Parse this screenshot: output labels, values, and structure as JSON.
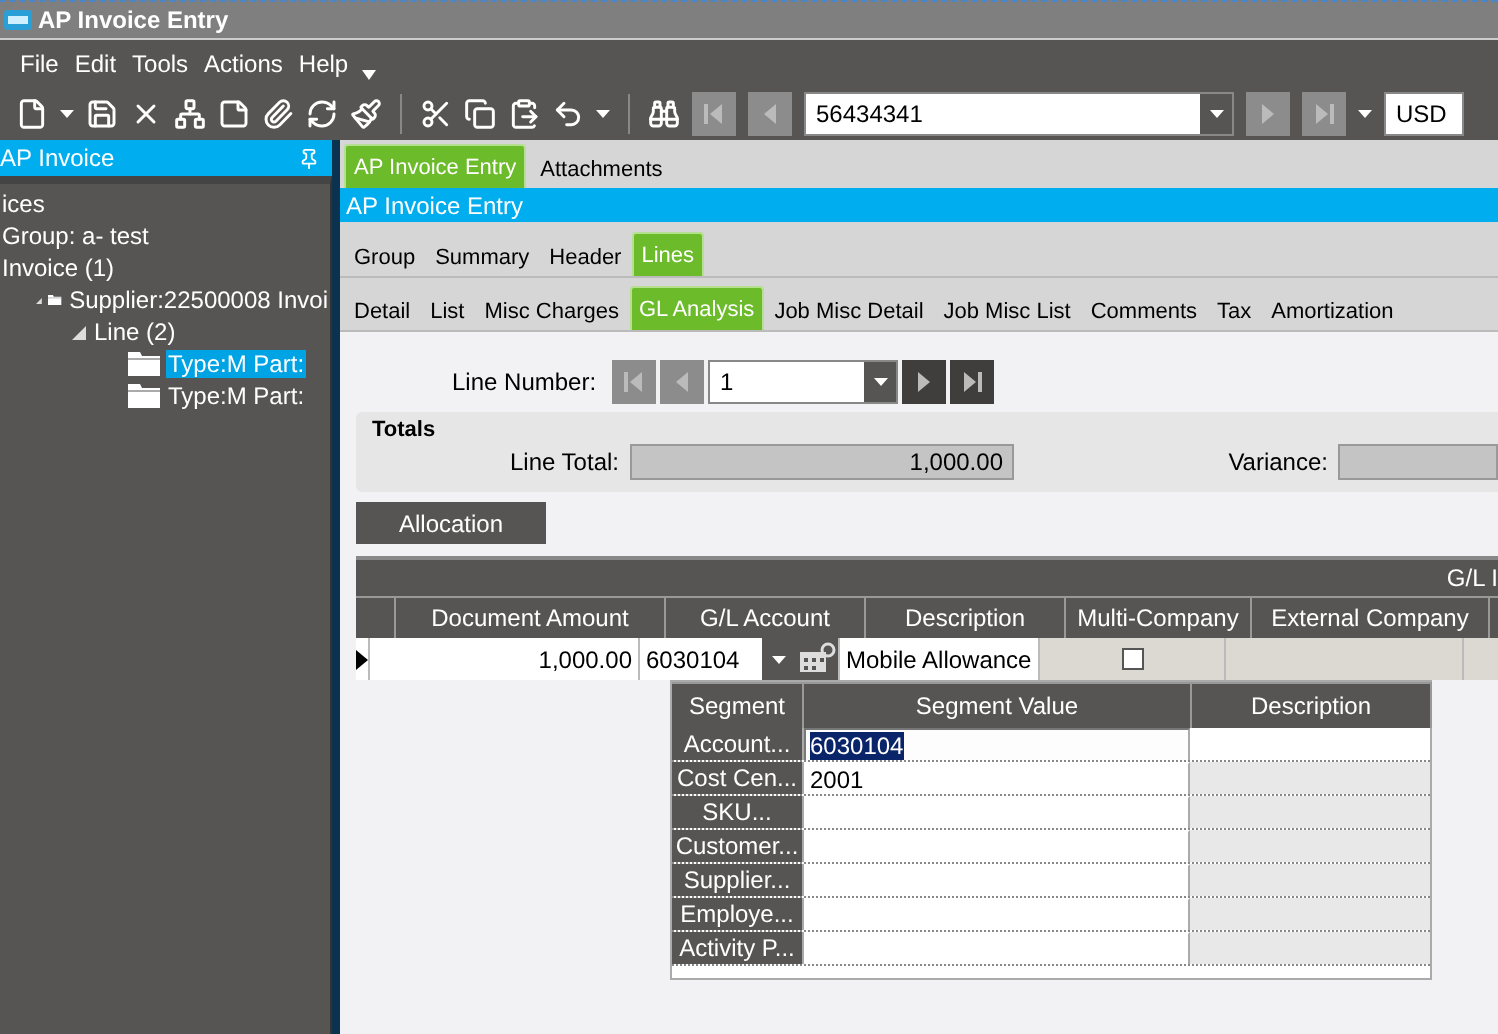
{
  "window": {
    "title": "AP Invoice Entry"
  },
  "menu": [
    "File",
    "Edit",
    "Tools",
    "Actions",
    "Help"
  ],
  "toolbar": {
    "record": "56434341",
    "currency": "USD"
  },
  "tree_panel": {
    "title": "AP Invoice",
    "items": [
      {
        "label": "ices",
        "selected": false
      },
      {
        "label": "Group: a- test",
        "selected": false
      },
      {
        "label": "Invoice (1)",
        "selected": false,
        "children": [
          {
            "label": "Supplier:22500008 Invoi",
            "kind": "folder",
            "selected": false,
            "expanded": true,
            "children": [
              {
                "label": "Line (2)",
                "selected": false,
                "expanded": true,
                "children": [
                  {
                    "label": "Type:M Part:",
                    "kind": "folder",
                    "selected": true
                  },
                  {
                    "label": "Type:M Part:",
                    "kind": "folder",
                    "selected": false
                  }
                ]
              }
            ]
          }
        ]
      }
    ]
  },
  "doc_tabs": [
    {
      "label": "AP Invoice Entry",
      "selected": true
    },
    {
      "label": "Attachments",
      "selected": false
    }
  ],
  "header": "AP Invoice Entry",
  "section_tabs": [
    {
      "label": "Group",
      "selected": false
    },
    {
      "label": "Summary",
      "selected": false
    },
    {
      "label": "Header",
      "selected": false
    },
    {
      "label": "Lines",
      "selected": true
    }
  ],
  "sub_tabs": [
    {
      "label": "Detail",
      "selected": false
    },
    {
      "label": "List",
      "selected": false
    },
    {
      "label": "Misc Charges",
      "selected": false
    },
    {
      "label": "GL Analysis",
      "selected": true
    },
    {
      "label": "Job Misc Detail",
      "selected": false
    },
    {
      "label": "Job Misc List",
      "selected": false
    },
    {
      "label": "Comments",
      "selected": false
    },
    {
      "label": "Tax",
      "selected": false
    },
    {
      "label": "Amortization",
      "selected": false
    }
  ],
  "line_number": {
    "label": "Line Number:",
    "value": "1"
  },
  "totals": {
    "title": "Totals",
    "line_total_label": "Line Total:",
    "line_total": "1,000.00",
    "variance_label": "Variance:"
  },
  "allocation_button": "Allocation",
  "grid": {
    "band": "G/L I",
    "columns": [
      "Document Amount",
      "G/L Account",
      "Description",
      "Multi-Company",
      "External Company"
    ],
    "rows": [
      {
        "document_amount": "1,000.00",
        "gl_account": "6030104",
        "description": "Mobile Allowance",
        "multi_company": false,
        "current": true
      }
    ]
  },
  "segments": {
    "columns": [
      "Segment",
      "Segment Value",
      "Description"
    ],
    "rows": [
      {
        "segment": "Account...",
        "value": "6030104",
        "selected": true
      },
      {
        "segment": "Cost Cen...",
        "value": "2001",
        "selected": false
      },
      {
        "segment": "SKU...",
        "selected": false
      },
      {
        "segment": "Customer...",
        "selected": false
      },
      {
        "segment": "Supplier...",
        "selected": false
      },
      {
        "segment": "Employe...",
        "selected": false
      },
      {
        "segment": "Activity P...",
        "selected": false
      }
    ]
  }
}
